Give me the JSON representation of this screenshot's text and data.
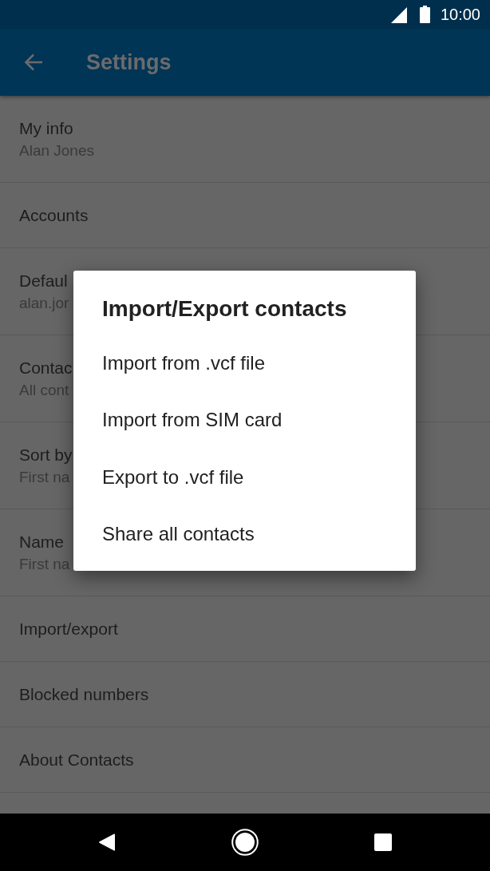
{
  "status_bar": {
    "time": "10:00"
  },
  "app_bar": {
    "title": "Settings"
  },
  "settings": [
    {
      "title": "My info",
      "subtitle": "Alan Jones"
    },
    {
      "title": "Accounts"
    },
    {
      "title": "Defaul",
      "subtitle": "alan.jor"
    },
    {
      "title": "Contac",
      "subtitle": "All cont"
    },
    {
      "title": "Sort by",
      "subtitle": "First na"
    },
    {
      "title": "Name",
      "subtitle": "First na"
    },
    {
      "title": "Import/export"
    },
    {
      "title": "Blocked numbers"
    },
    {
      "title": "About Contacts"
    }
  ],
  "dialog": {
    "title": "Import/Export contacts",
    "options": [
      "Import from .vcf file",
      "Import from SIM card",
      "Export to .vcf file",
      "Share all contacts"
    ]
  }
}
